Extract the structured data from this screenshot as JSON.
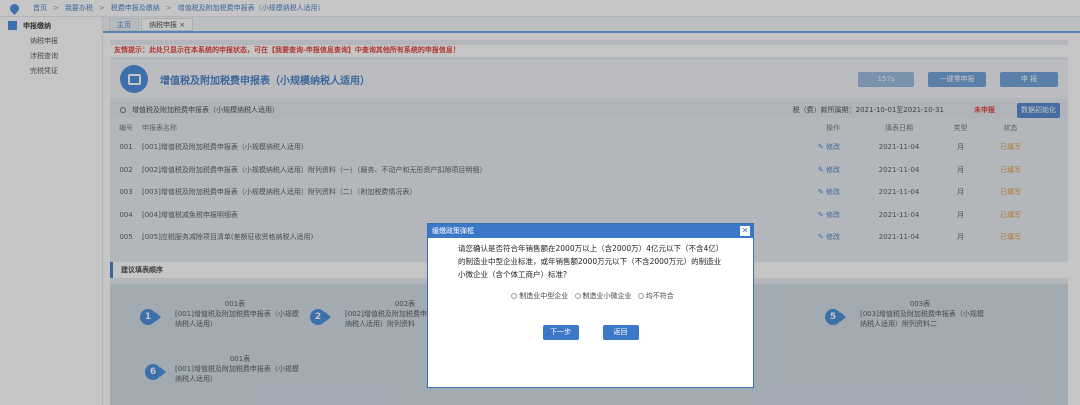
{
  "breadcrumb": {
    "items": [
      "首页",
      ">",
      "我要办税",
      ">",
      "税费申报及缴纳",
      ">",
      "增值税及附加税费申报表（小规模纳税人适用）"
    ]
  },
  "sidebar": {
    "title": "申报缴纳",
    "items": [
      "纳税申报",
      "涉税查询",
      "完税凭证"
    ]
  },
  "tabs": [
    "主页",
    "纳税申报 ×"
  ],
  "notice": "友情提示：此处只显示在本系统的申报状态，可在【我要查询-申报信息查询】中查询其他所有系统的申报信息！",
  "banner": {
    "title": "增值税及附加税费申报表（小规模纳税人适用）",
    "timer": "157s",
    "zero_btn": "一键零申报",
    "submit_btn": "申 报"
  },
  "bar": {
    "label": "增值税及附加税费申报表（小规模纳税人适用）",
    "period": "税（费）款所属期：2021-10-01至2021-10-31",
    "status": "未申报",
    "reset_btn": "数据初始化"
  },
  "table": {
    "headers": [
      "编号",
      "申报表名称",
      "操作",
      "填表日期",
      "类型",
      "状态"
    ],
    "rows": [
      {
        "no": "001",
        "name": "[001]增值税及附加税费申报表（小规模纳税人适用）",
        "op": "✎ 修改",
        "date": "2021-11-04",
        "type": "月",
        "status": "已填写"
      },
      {
        "no": "002",
        "name": "[002]增值税及附加税费申报表（小规模纳税人适用）附列资料（一）（服务、不动产和无形资产扣除项目明细）",
        "op": "✎ 修改",
        "date": "2021-11-04",
        "type": "月",
        "status": "已填写"
      },
      {
        "no": "003",
        "name": "[003]增值税及附加税费申报表（小规模纳税人适用）附列资料（二）（附加税费情况表）",
        "op": "✎ 修改",
        "date": "2021-11-04",
        "type": "月",
        "status": "已填写"
      },
      {
        "no": "004",
        "name": "[004]增值税减免税申报明细表",
        "op": "✎ 修改",
        "date": "2021-11-04",
        "type": "月",
        "status": "已填写"
      },
      {
        "no": "005",
        "name": "[005]应税服务减除项目清单(差额征收资格纳税人适用)",
        "op": "✎ 修改",
        "date": "2021-11-04",
        "type": "月",
        "status": "已填写"
      }
    ]
  },
  "suggest": {
    "title": "建议填表顺序"
  },
  "steps": [
    {
      "num": "1",
      "name": "001表",
      "desc": "[001]增值税及附加税费申报表（小规模纳税人适用）"
    },
    {
      "num": "2",
      "name": "002表",
      "desc": "[002]增值税及附加税费申报表（小规模纳税人适用）附列资料"
    },
    {
      "num": "5",
      "name": "003表",
      "desc": "[003]增值税及附加税费申报表（小规模纳税人适用）附列资料二"
    },
    {
      "num": "6",
      "name": "001表",
      "desc": "[001]增值税及附加税费申报表（小规模纳税人适用）"
    }
  ],
  "modal": {
    "title": "缓缴政策弹框",
    "question": "请您确认是否符合年销售额在2000万以上（含2000万）4亿元以下（不含4亿）的制造业中型企业标准，或年销售额2000万元以下（不含2000万元）的制造业小微企业（含个体工商户）标准？",
    "options": [
      "制造业中型企业",
      "制造业小微企业",
      "均不符合"
    ],
    "next_btn": "下一步",
    "back_btn": "返回"
  }
}
